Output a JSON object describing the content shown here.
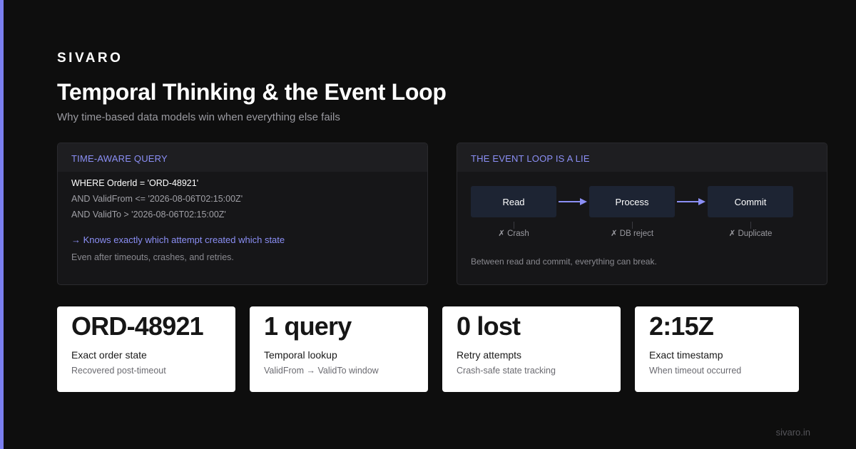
{
  "brand": "SIVARO",
  "title": "Temporal Thinking & the Event Loop",
  "subtitle": "Why time-based data models win when everything else fails",
  "colors": {
    "accent": "#7b7ff0",
    "panel_heading": "#8b8ff5",
    "background": "#0e0e0e",
    "stage_box": "#1d2433"
  },
  "query_panel": {
    "heading": "TIME-AWARE QUERY",
    "lines": [
      "WHERE OrderId = 'ORD-48921'",
      "AND ValidFrom <= '2026-08-06T02:15:00Z'",
      "AND ValidTo > '2026-08-06T02:15:00Z'"
    ],
    "highlight": "→ Knows exactly which attempt created which state",
    "note": "Even after timeouts, crashes, and retries."
  },
  "loop_panel": {
    "heading": "THE EVENT LOOP IS A LIE",
    "stages": [
      {
        "label": "Read",
        "failure": "✗ Crash"
      },
      {
        "label": "Process",
        "failure": "✗ DB reject"
      },
      {
        "label": "Commit",
        "failure": "✗ Duplicate"
      }
    ],
    "arrow_icon": "right-arrow-icon",
    "note": "Between read and commit, everything can break."
  },
  "stats": [
    {
      "value": "ORD-48921",
      "label": "Exact order state",
      "desc": "Recovered post-timeout"
    },
    {
      "value": "1 query",
      "label": "Temporal lookup",
      "desc": "ValidFrom → ValidTo window"
    },
    {
      "value": "0 lost",
      "label": "Retry attempts",
      "desc": "Crash-safe state tracking"
    },
    {
      "value": "2:15Z",
      "label": "Exact timestamp",
      "desc": "When timeout occurred"
    }
  ],
  "footer": "sivaro.in"
}
